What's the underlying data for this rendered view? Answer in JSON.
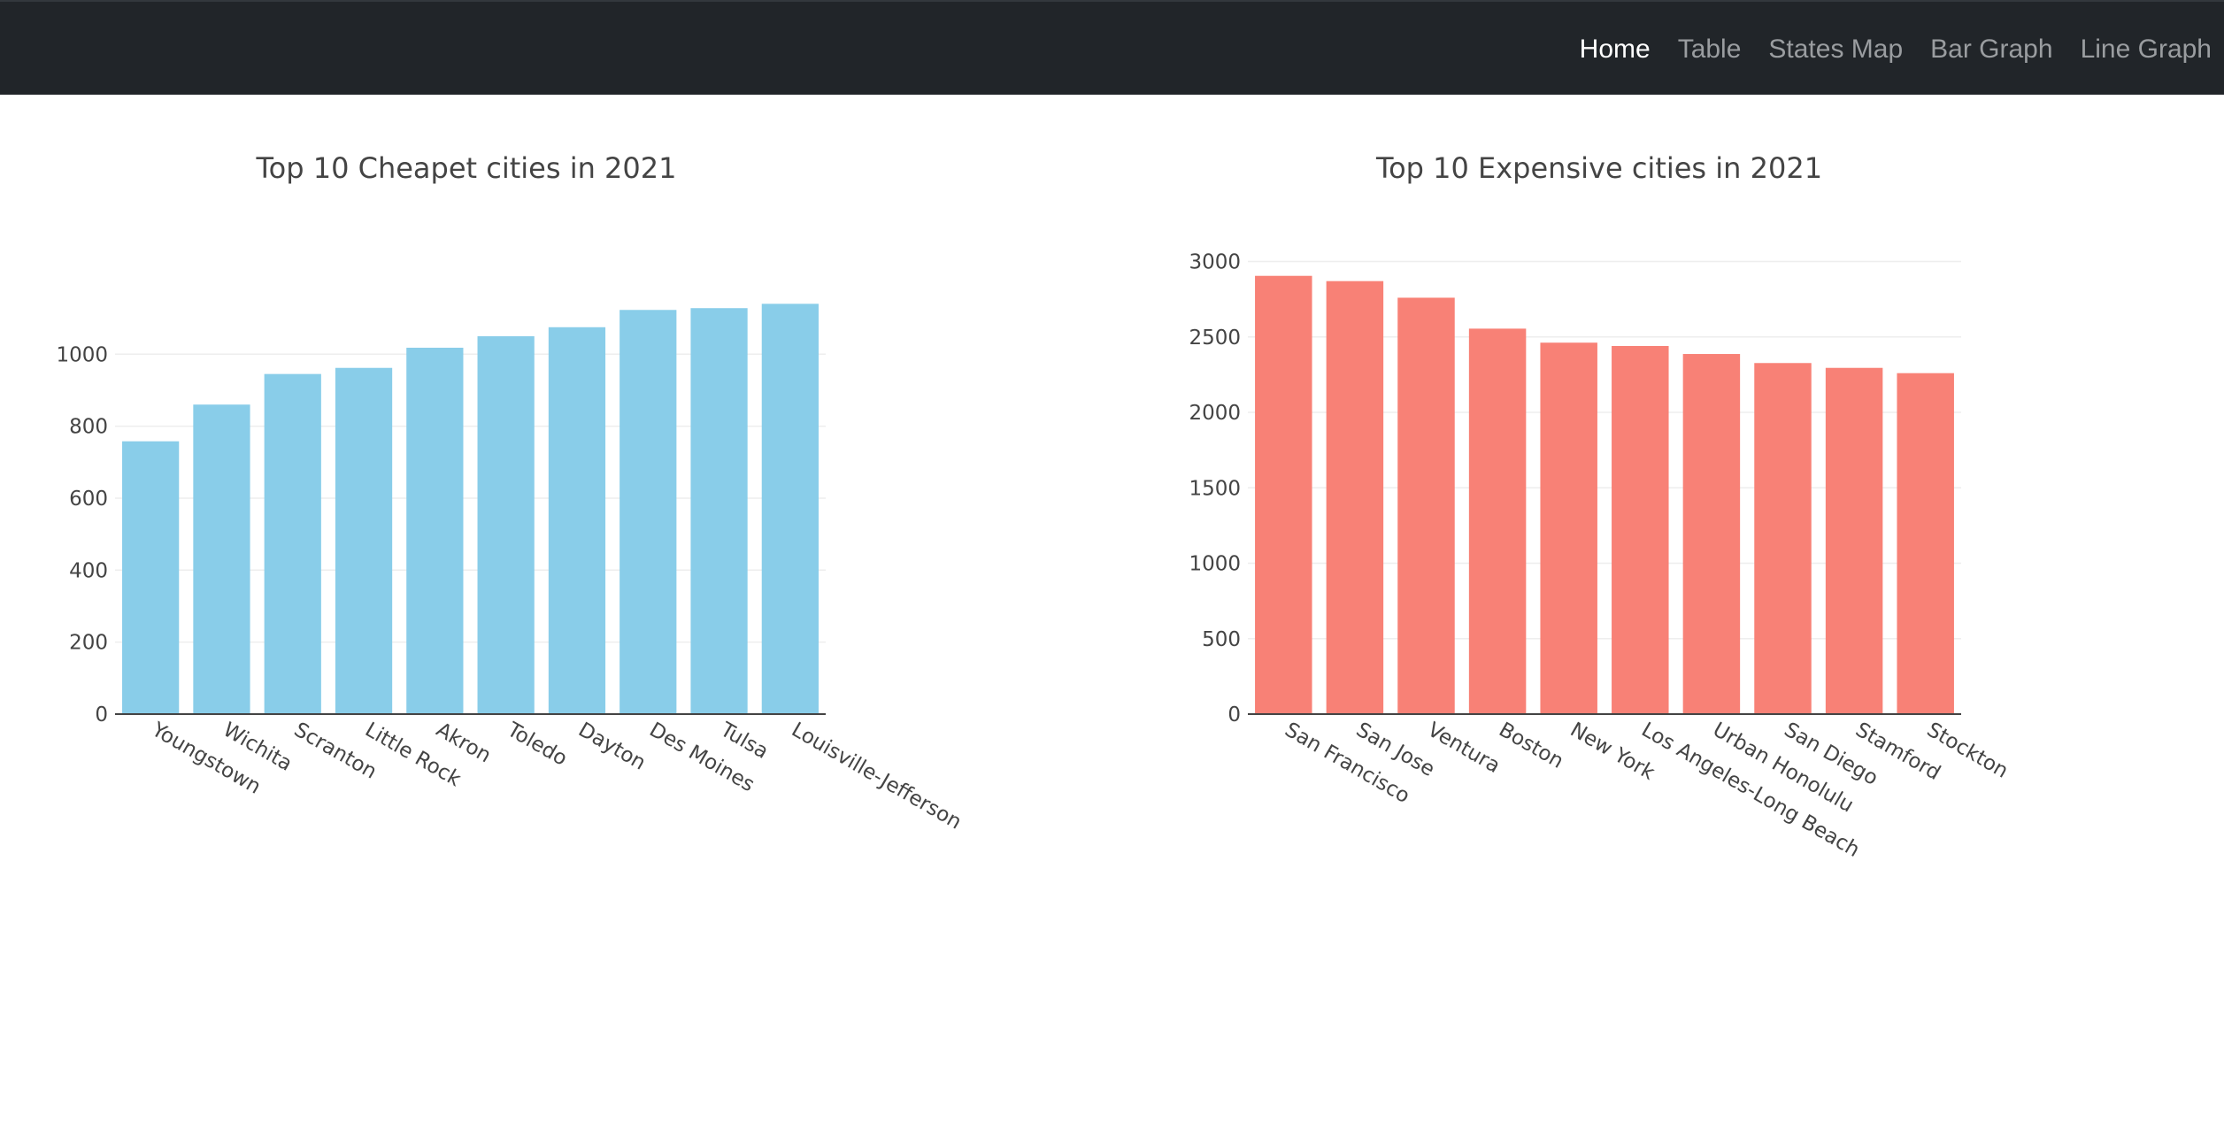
{
  "nav": {
    "items": [
      {
        "label": "Home",
        "active": true
      },
      {
        "label": "Table",
        "active": false
      },
      {
        "label": "States Map",
        "active": false
      },
      {
        "label": "Bar Graph",
        "active": false
      },
      {
        "label": "Line Graph",
        "active": false
      }
    ],
    "background": "#212529"
  },
  "chart_data": [
    {
      "type": "bar",
      "title": "Top 10 Cheapet cities in 2021",
      "color": "#89cde9",
      "categories": [
        "Youngstown",
        "Wichita",
        "Scranton",
        "Little Rock",
        "Akron",
        "Toledo",
        "Dayton",
        "Des Moines",
        "Tulsa",
        "Louisville-Jefferson"
      ],
      "values": [
        758,
        860,
        945,
        962,
        1018,
        1050,
        1075,
        1123,
        1128,
        1140
      ],
      "ylim": [
        0,
        1190
      ],
      "yticks": [
        0,
        200,
        400,
        600,
        800,
        1000
      ],
      "xlabel": "",
      "ylabel": "",
      "grid": true
    },
    {
      "type": "bar",
      "title": "Top 10 Expensive cities in 2021",
      "color": "#f88176",
      "categories": [
        "San Francisco",
        "San Jose",
        "Ventura",
        "Boston",
        "New York",
        "Los Angeles-Long Beach",
        "Urban Honolulu",
        "San Diego",
        "Stamford",
        "Stockton"
      ],
      "values": [
        2905,
        2870,
        2760,
        2555,
        2462,
        2440,
        2387,
        2327,
        2295,
        2260
      ],
      "ylim": [
        0,
        3050
      ],
      "yticks": [
        0,
        500,
        1000,
        1500,
        2000,
        2500,
        3000
      ],
      "xlabel": "",
      "ylabel": "",
      "grid": true
    }
  ]
}
